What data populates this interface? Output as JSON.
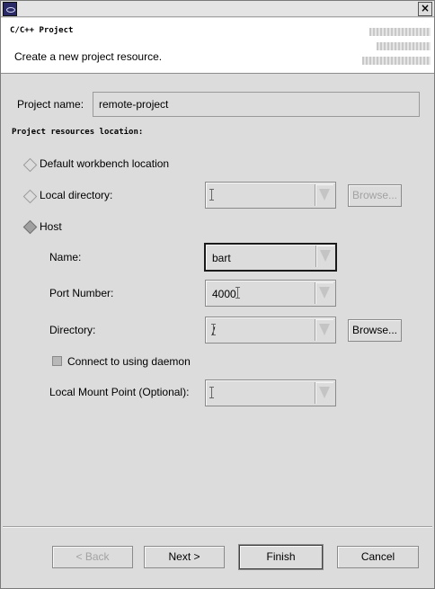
{
  "window": {
    "close_glyph": "×"
  },
  "banner": {
    "title": "C/C++ Project",
    "description": "Create a new project resource."
  },
  "project_name": {
    "label": "Project name:",
    "value": "remote-project"
  },
  "location": {
    "section_title": "Project resources location:",
    "default_option": "Default workbench location",
    "local_option": "Local directory:",
    "local_browse": "Browse...",
    "host_option": "Host",
    "selected": "Host"
  },
  "host": {
    "name_label": "Name:",
    "name_value": "bart",
    "port_label": "Port Number:",
    "port_value": "4000",
    "directory_label": "Directory:",
    "directory_value": "/",
    "directory_browse": "Browse...",
    "daemon_label": "Connect to using daemon",
    "daemon_checked": false,
    "mount_label": "Local Mount Point (Optional):",
    "mount_value": ""
  },
  "buttons": {
    "back": "< Back",
    "next": "Next >",
    "finish": "Finish",
    "cancel": "Cancel"
  }
}
